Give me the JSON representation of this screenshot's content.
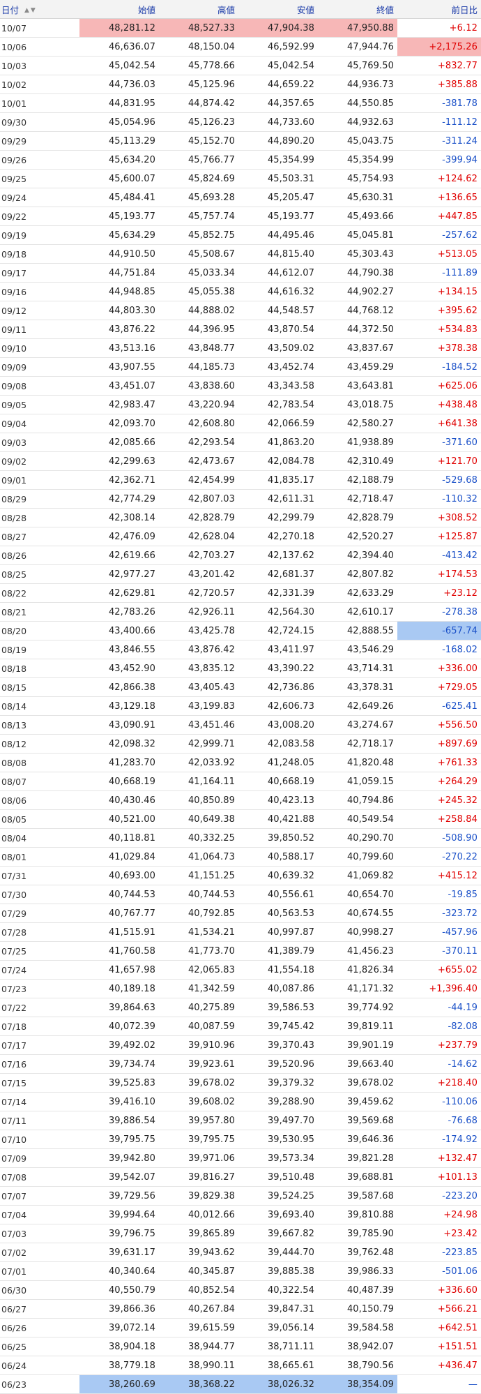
{
  "header": {
    "date_label": "日付",
    "open_label": "始値",
    "high_label": "高値",
    "low_label": "安値",
    "close_label": "終値",
    "change_label": "前日比",
    "sort_icons": [
      "sort-asc-icon",
      "sort-desc-icon"
    ]
  },
  "colors": {
    "up": "#e00000",
    "down": "#1a50c8",
    "highlight_red": "#f7b7b7",
    "highlight_blue": "#a9c9f3",
    "header_text": "#1a3aa8"
  },
  "rows": [
    {
      "date": "10/07",
      "open": "48,281.12",
      "high": "48,527.33",
      "low": "47,904.38",
      "close": "47,950.88",
      "change": "+6.12",
      "hl": {
        "open": "red",
        "high": "red",
        "low": "red",
        "close": "red"
      }
    },
    {
      "date": "10/06",
      "open": "46,636.07",
      "high": "48,150.04",
      "low": "46,592.99",
      "close": "47,944.76",
      "change": "+2,175.26",
      "hl": {
        "change": "red"
      }
    },
    {
      "date": "10/03",
      "open": "45,042.54",
      "high": "45,778.66",
      "low": "45,042.54",
      "close": "45,769.50",
      "change": "+832.77"
    },
    {
      "date": "10/02",
      "open": "44,736.03",
      "high": "45,125.96",
      "low": "44,659.22",
      "close": "44,936.73",
      "change": "+385.88"
    },
    {
      "date": "10/01",
      "open": "44,831.95",
      "high": "44,874.42",
      "low": "44,357.65",
      "close": "44,550.85",
      "change": "-381.78"
    },
    {
      "date": "09/30",
      "open": "45,054.96",
      "high": "45,126.23",
      "low": "44,733.60",
      "close": "44,932.63",
      "change": "-111.12"
    },
    {
      "date": "09/29",
      "open": "45,113.29",
      "high": "45,152.70",
      "low": "44,890.20",
      "close": "45,043.75",
      "change": "-311.24"
    },
    {
      "date": "09/26",
      "open": "45,634.20",
      "high": "45,766.77",
      "low": "45,354.99",
      "close": "45,354.99",
      "change": "-399.94"
    },
    {
      "date": "09/25",
      "open": "45,600.07",
      "high": "45,824.69",
      "low": "45,503.31",
      "close": "45,754.93",
      "change": "+124.62"
    },
    {
      "date": "09/24",
      "open": "45,484.41",
      "high": "45,693.28",
      "low": "45,205.47",
      "close": "45,630.31",
      "change": "+136.65"
    },
    {
      "date": "09/22",
      "open": "45,193.77",
      "high": "45,757.74",
      "low": "45,193.77",
      "close": "45,493.66",
      "change": "+447.85"
    },
    {
      "date": "09/19",
      "open": "45,634.29",
      "high": "45,852.75",
      "low": "44,495.46",
      "close": "45,045.81",
      "change": "-257.62"
    },
    {
      "date": "09/18",
      "open": "44,910.50",
      "high": "45,508.67",
      "low": "44,815.40",
      "close": "45,303.43",
      "change": "+513.05"
    },
    {
      "date": "09/17",
      "open": "44,751.84",
      "high": "45,033.34",
      "low": "44,612.07",
      "close": "44,790.38",
      "change": "-111.89"
    },
    {
      "date": "09/16",
      "open": "44,948.85",
      "high": "45,055.38",
      "low": "44,616.32",
      "close": "44,902.27",
      "change": "+134.15"
    },
    {
      "date": "09/12",
      "open": "44,803.30",
      "high": "44,888.02",
      "low": "44,548.57",
      "close": "44,768.12",
      "change": "+395.62"
    },
    {
      "date": "09/11",
      "open": "43,876.22",
      "high": "44,396.95",
      "low": "43,870.54",
      "close": "44,372.50",
      "change": "+534.83"
    },
    {
      "date": "09/10",
      "open": "43,513.16",
      "high": "43,848.77",
      "low": "43,509.02",
      "close": "43,837.67",
      "change": "+378.38"
    },
    {
      "date": "09/09",
      "open": "43,907.55",
      "high": "44,185.73",
      "low": "43,452.74",
      "close": "43,459.29",
      "change": "-184.52"
    },
    {
      "date": "09/08",
      "open": "43,451.07",
      "high": "43,838.60",
      "low": "43,343.58",
      "close": "43,643.81",
      "change": "+625.06"
    },
    {
      "date": "09/05",
      "open": "42,983.47",
      "high": "43,220.94",
      "low": "42,783.54",
      "close": "43,018.75",
      "change": "+438.48"
    },
    {
      "date": "09/04",
      "open": "42,093.70",
      "high": "42,608.80",
      "low": "42,066.59",
      "close": "42,580.27",
      "change": "+641.38"
    },
    {
      "date": "09/03",
      "open": "42,085.66",
      "high": "42,293.54",
      "low": "41,863.20",
      "close": "41,938.89",
      "change": "-371.60"
    },
    {
      "date": "09/02",
      "open": "42,299.63",
      "high": "42,473.67",
      "low": "42,084.78",
      "close": "42,310.49",
      "change": "+121.70"
    },
    {
      "date": "09/01",
      "open": "42,362.71",
      "high": "42,454.99",
      "low": "41,835.17",
      "close": "42,188.79",
      "change": "-529.68"
    },
    {
      "date": "08/29",
      "open": "42,774.29",
      "high": "42,807.03",
      "low": "42,611.31",
      "close": "42,718.47",
      "change": "-110.32"
    },
    {
      "date": "08/28",
      "open": "42,308.14",
      "high": "42,828.79",
      "low": "42,299.79",
      "close": "42,828.79",
      "change": "+308.52"
    },
    {
      "date": "08/27",
      "open": "42,476.09",
      "high": "42,628.04",
      "low": "42,270.18",
      "close": "42,520.27",
      "change": "+125.87"
    },
    {
      "date": "08/26",
      "open": "42,619.66",
      "high": "42,703.27",
      "low": "42,137.62",
      "close": "42,394.40",
      "change": "-413.42"
    },
    {
      "date": "08/25",
      "open": "42,977.27",
      "high": "43,201.42",
      "low": "42,681.37",
      "close": "42,807.82",
      "change": "+174.53"
    },
    {
      "date": "08/22",
      "open": "42,629.81",
      "high": "42,720.57",
      "low": "42,331.39",
      "close": "42,633.29",
      "change": "+23.12"
    },
    {
      "date": "08/21",
      "open": "42,783.26",
      "high": "42,926.11",
      "low": "42,564.30",
      "close": "42,610.17",
      "change": "-278.38"
    },
    {
      "date": "08/20",
      "open": "43,400.66",
      "high": "43,425.78",
      "low": "42,724.15",
      "close": "42,888.55",
      "change": "-657.74",
      "hl": {
        "change": "blue"
      }
    },
    {
      "date": "08/19",
      "open": "43,846.55",
      "high": "43,876.42",
      "low": "43,411.97",
      "close": "43,546.29",
      "change": "-168.02"
    },
    {
      "date": "08/18",
      "open": "43,452.90",
      "high": "43,835.12",
      "low": "43,390.22",
      "close": "43,714.31",
      "change": "+336.00"
    },
    {
      "date": "08/15",
      "open": "42,866.38",
      "high": "43,405.43",
      "low": "42,736.86",
      "close": "43,378.31",
      "change": "+729.05"
    },
    {
      "date": "08/14",
      "open": "43,129.18",
      "high": "43,199.83",
      "low": "42,606.73",
      "close": "42,649.26",
      "change": "-625.41"
    },
    {
      "date": "08/13",
      "open": "43,090.91",
      "high": "43,451.46",
      "low": "43,008.20",
      "close": "43,274.67",
      "change": "+556.50"
    },
    {
      "date": "08/12",
      "open": "42,098.32",
      "high": "42,999.71",
      "low": "42,083.58",
      "close": "42,718.17",
      "change": "+897.69"
    },
    {
      "date": "08/08",
      "open": "41,283.70",
      "high": "42,033.92",
      "low": "41,248.05",
      "close": "41,820.48",
      "change": "+761.33"
    },
    {
      "date": "08/07",
      "open": "40,668.19",
      "high": "41,164.11",
      "low": "40,668.19",
      "close": "41,059.15",
      "change": "+264.29"
    },
    {
      "date": "08/06",
      "open": "40,430.46",
      "high": "40,850.89",
      "low": "40,423.13",
      "close": "40,794.86",
      "change": "+245.32"
    },
    {
      "date": "08/05",
      "open": "40,521.00",
      "high": "40,649.38",
      "low": "40,421.88",
      "close": "40,549.54",
      "change": "+258.84"
    },
    {
      "date": "08/04",
      "open": "40,118.81",
      "high": "40,332.25",
      "low": "39,850.52",
      "close": "40,290.70",
      "change": "-508.90"
    },
    {
      "date": "08/01",
      "open": "41,029.84",
      "high": "41,064.73",
      "low": "40,588.17",
      "close": "40,799.60",
      "change": "-270.22"
    },
    {
      "date": "07/31",
      "open": "40,693.00",
      "high": "41,151.25",
      "low": "40,639.32",
      "close": "41,069.82",
      "change": "+415.12"
    },
    {
      "date": "07/30",
      "open": "40,744.53",
      "high": "40,744.53",
      "low": "40,556.61",
      "close": "40,654.70",
      "change": "-19.85"
    },
    {
      "date": "07/29",
      "open": "40,767.77",
      "high": "40,792.85",
      "low": "40,563.53",
      "close": "40,674.55",
      "change": "-323.72"
    },
    {
      "date": "07/28",
      "open": "41,515.91",
      "high": "41,534.21",
      "low": "40,997.87",
      "close": "40,998.27",
      "change": "-457.96"
    },
    {
      "date": "07/25",
      "open": "41,760.58",
      "high": "41,773.70",
      "low": "41,389.79",
      "close": "41,456.23",
      "change": "-370.11"
    },
    {
      "date": "07/24",
      "open": "41,657.98",
      "high": "42,065.83",
      "low": "41,554.18",
      "close": "41,826.34",
      "change": "+655.02"
    },
    {
      "date": "07/23",
      "open": "40,189.18",
      "high": "41,342.59",
      "low": "40,087.86",
      "close": "41,171.32",
      "change": "+1,396.40"
    },
    {
      "date": "07/22",
      "open": "39,864.63",
      "high": "40,275.89",
      "low": "39,586.53",
      "close": "39,774.92",
      "change": "-44.19"
    },
    {
      "date": "07/18",
      "open": "40,072.39",
      "high": "40,087.59",
      "low": "39,745.42",
      "close": "39,819.11",
      "change": "-82.08"
    },
    {
      "date": "07/17",
      "open": "39,492.02",
      "high": "39,910.96",
      "low": "39,370.43",
      "close": "39,901.19",
      "change": "+237.79"
    },
    {
      "date": "07/16",
      "open": "39,734.74",
      "high": "39,923.61",
      "low": "39,520.96",
      "close": "39,663.40",
      "change": "-14.62"
    },
    {
      "date": "07/15",
      "open": "39,525.83",
      "high": "39,678.02",
      "low": "39,379.32",
      "close": "39,678.02",
      "change": "+218.40"
    },
    {
      "date": "07/14",
      "open": "39,416.10",
      "high": "39,608.02",
      "low": "39,288.90",
      "close": "39,459.62",
      "change": "-110.06"
    },
    {
      "date": "07/11",
      "open": "39,886.54",
      "high": "39,957.80",
      "low": "39,497.70",
      "close": "39,569.68",
      "change": "-76.68"
    },
    {
      "date": "07/10",
      "open": "39,795.75",
      "high": "39,795.75",
      "low": "39,530.95",
      "close": "39,646.36",
      "change": "-174.92"
    },
    {
      "date": "07/09",
      "open": "39,942.80",
      "high": "39,971.06",
      "low": "39,573.34",
      "close": "39,821.28",
      "change": "+132.47"
    },
    {
      "date": "07/08",
      "open": "39,542.07",
      "high": "39,816.27",
      "low": "39,510.48",
      "close": "39,688.81",
      "change": "+101.13"
    },
    {
      "date": "07/07",
      "open": "39,729.56",
      "high": "39,829.38",
      "low": "39,524.25",
      "close": "39,587.68",
      "change": "-223.20"
    },
    {
      "date": "07/04",
      "open": "39,994.64",
      "high": "40,012.66",
      "low": "39,693.40",
      "close": "39,810.88",
      "change": "+24.98"
    },
    {
      "date": "07/03",
      "open": "39,796.75",
      "high": "39,865.89",
      "low": "39,667.82",
      "close": "39,785.90",
      "change": "+23.42"
    },
    {
      "date": "07/02",
      "open": "39,631.17",
      "high": "39,943.62",
      "low": "39,444.70",
      "close": "39,762.48",
      "change": "-223.85"
    },
    {
      "date": "07/01",
      "open": "40,340.64",
      "high": "40,345.87",
      "low": "39,885.38",
      "close": "39,986.33",
      "change": "-501.06"
    },
    {
      "date": "06/30",
      "open": "40,550.79",
      "high": "40,852.54",
      "low": "40,322.54",
      "close": "40,487.39",
      "change": "+336.60"
    },
    {
      "date": "06/27",
      "open": "39,866.36",
      "high": "40,267.84",
      "low": "39,847.31",
      "close": "40,150.79",
      "change": "+566.21"
    },
    {
      "date": "06/26",
      "open": "39,072.14",
      "high": "39,615.59",
      "low": "39,056.14",
      "close": "39,584.58",
      "change": "+642.51"
    },
    {
      "date": "06/25",
      "open": "38,904.18",
      "high": "38,944.77",
      "low": "38,711.11",
      "close": "38,942.07",
      "change": "+151.51"
    },
    {
      "date": "06/24",
      "open": "38,779.18",
      "high": "38,990.11",
      "low": "38,665.61",
      "close": "38,790.56",
      "change": "+436.47"
    },
    {
      "date": "06/23",
      "open": "38,260.69",
      "high": "38,368.22",
      "low": "38,026.32",
      "close": "38,354.09",
      "change": "—",
      "hl": {
        "open": "blue",
        "high": "blue",
        "low": "blue",
        "close": "blue"
      }
    }
  ]
}
